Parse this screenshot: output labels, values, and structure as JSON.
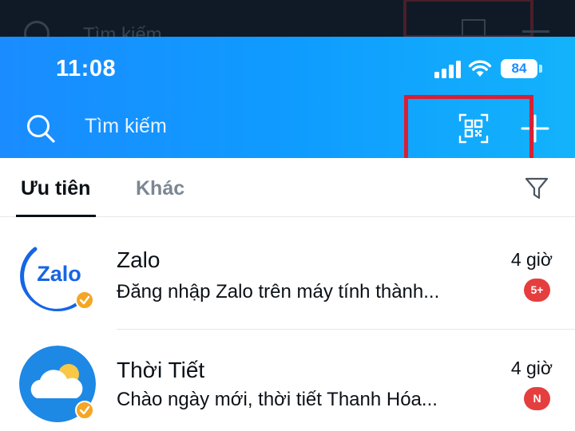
{
  "status_bar": {
    "time": "11:08",
    "battery": "84"
  },
  "ghost": {
    "search_text": "Tìm kiếm"
  },
  "header": {
    "search_placeholder": "Tìm kiếm",
    "icons": [
      "search-icon",
      "qr-code-icon",
      "plus-icon"
    ],
    "highlight_color": "#d81f35"
  },
  "tabs": [
    {
      "label": "Ưu tiên",
      "active": true
    },
    {
      "label": "Khác",
      "active": false
    }
  ],
  "conversations": [
    {
      "name": "Zalo",
      "preview": "Đăng nhập Zalo trên máy tính thành...",
      "time": "4 giờ",
      "badge": "5+",
      "avatar_text": "Zalo",
      "verified": true
    },
    {
      "name": "Thời Tiết",
      "preview": "Chào ngày mới, thời tiết Thanh Hóa...",
      "time": "4 giờ",
      "badge": "N",
      "verified": true
    }
  ],
  "colors": {
    "header_blue": "#1a8cff",
    "badge_red": "#e53e3e",
    "verified_orange": "#f5a623"
  }
}
